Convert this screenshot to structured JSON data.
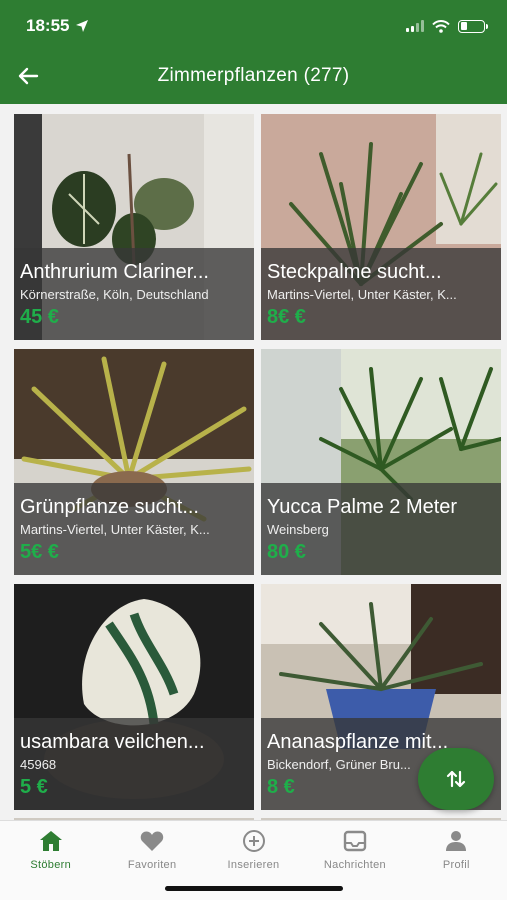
{
  "status_bar": {
    "time": "18:55"
  },
  "header": {
    "title": "Zimmerpflanzen (277)"
  },
  "listings": [
    {
      "title": "Anthrurium Clariner...",
      "location": "Körnerstraße, Köln, Deutschland",
      "price": "45 €"
    },
    {
      "title": "Steckpalme sucht...",
      "location": "Martins-Viertel, Unter Käster, K...",
      "price": "8€ €"
    },
    {
      "title": "Grünpflanze sucht...",
      "location": "Martins-Viertel, Unter Käster, K...",
      "price": "5€ €"
    },
    {
      "title": "Yucca Palme 2 Meter",
      "location": "Weinsberg",
      "price": "80 €"
    },
    {
      "title": "usambara veilchen...",
      "location": "45968",
      "price": "5 €"
    },
    {
      "title": "Ananaspflanze mit...",
      "location": "Bickendorf, Grüner Bru...",
      "price": "8 €"
    }
  ],
  "tabs": [
    {
      "label": "Stöbern"
    },
    {
      "label": "Favoriten"
    },
    {
      "label": "Inserieren"
    },
    {
      "label": "Nachrichten"
    },
    {
      "label": "Profil"
    }
  ],
  "colors": {
    "brand": "#2e7d32",
    "price": "#1fae4a"
  }
}
